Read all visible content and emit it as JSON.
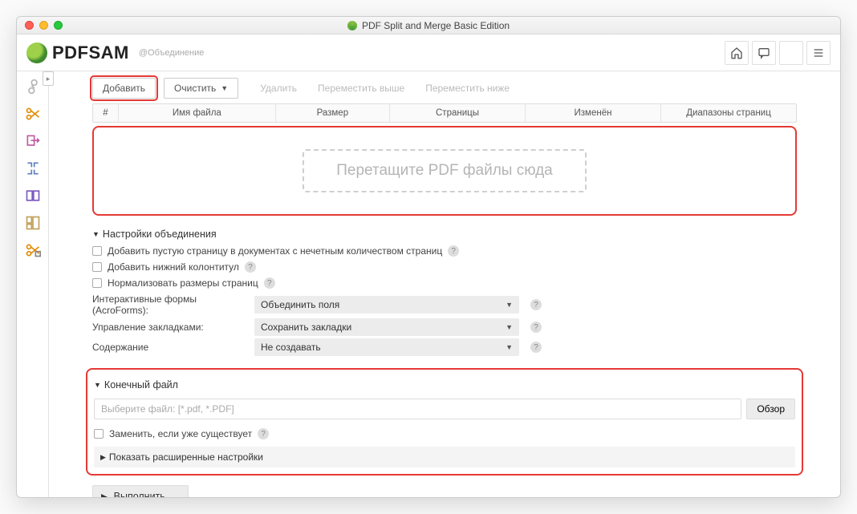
{
  "window": {
    "title": "PDF Split and Merge Basic Edition"
  },
  "branding": {
    "brand": "PDFSAM",
    "subtitle": "@Объединение"
  },
  "toolbar": {
    "add": "Добавить",
    "clear": "Очистить",
    "delete": "Удалить",
    "move_up": "Переместить выше",
    "move_down": "Переместить ниже"
  },
  "columns": {
    "num": "#",
    "filename": "Имя файла",
    "size": "Размер",
    "pages": "Страницы",
    "modified": "Изменён",
    "ranges": "Диапазоны страниц"
  },
  "dropzone": {
    "hint": "Перетащите PDF файлы сюда"
  },
  "merge_settings": {
    "title": "Настройки объединения",
    "add_blank": "Добавить пустую страницу в документах с нечетным количеством страниц",
    "footer": "Добавить нижний колонтитул",
    "normalize": "Нормализовать размеры страниц",
    "acroforms_label": "Интерактивные формы (AcroForms):",
    "acroforms_value": "Объединить поля",
    "bookmarks_label": "Управление закладками:",
    "bookmarks_value": "Сохранить закладки",
    "toc_label": "Содержание",
    "toc_value": "Не создавать"
  },
  "output": {
    "title": "Конечный файл",
    "placeholder": "Выберите файл: [*.pdf, *.PDF]",
    "browse": "Обзор",
    "overwrite": "Заменить, если уже существует",
    "advanced": "Показать расширенные настройки"
  },
  "run": {
    "label": "Выполнить"
  }
}
